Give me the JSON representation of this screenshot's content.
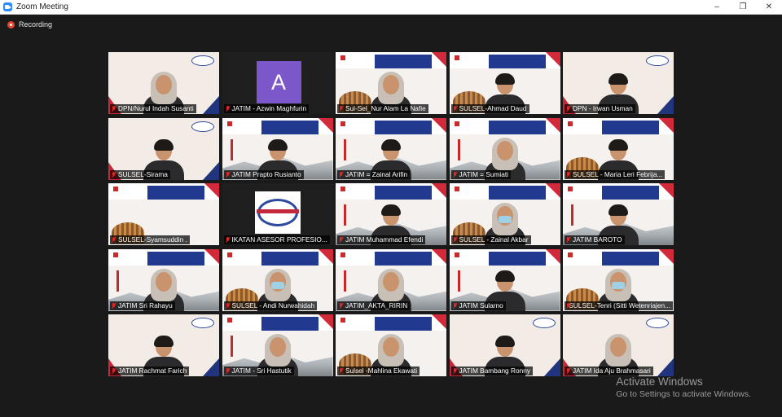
{
  "window": {
    "title": "Zoom Meeting",
    "controls": {
      "minimize": "–",
      "maximize": "❐",
      "close": "✕"
    }
  },
  "recording": {
    "label": "Recording"
  },
  "participants": [
    {
      "name": "DPN/Nurul Indah Susanti",
      "bg": "cream",
      "person": "hijab",
      "active": true
    },
    {
      "name": "JATIM - Azwin Maghfurin",
      "bg": "black",
      "avatar_letter": "A"
    },
    {
      "name": "Sul-Sel_Nur Alam La Nafie",
      "bg": "iaspro",
      "person": "hijab"
    },
    {
      "name": "SULSEL-Ahmad Daud",
      "bg": "iaspro",
      "person": "man"
    },
    {
      "name": "DPN - Irwan Usman",
      "bg": "cream",
      "person": "man"
    },
    {
      "name": "SULSEL-Sirama",
      "bg": "cream",
      "person": "man"
    },
    {
      "name": "JATIM Prapto Rusianto",
      "bg": "jatim",
      "person": "man"
    },
    {
      "name": "JATIM = Zainal Arifin",
      "bg": "jatim",
      "person": "man"
    },
    {
      "name": "JATIM = Sumiati",
      "bg": "jatim",
      "person": "hijab"
    },
    {
      "name": "SULSEL - Maria Leri Febrija...",
      "bg": "iaspro",
      "person": "man"
    },
    {
      "name": "SULSEL-Syamsuddin .",
      "bg": "iaspro",
      "person": "none"
    },
    {
      "name": "IKATAN ASESOR PROFESIO...",
      "bg": "black",
      "logo": "iaspro"
    },
    {
      "name": "JATIM Muhammad Efendi",
      "bg": "jatim",
      "person": "man"
    },
    {
      "name": "SULSEL - Zainal Akbar",
      "bg": "iaspro",
      "person": "mask"
    },
    {
      "name": "JATIM BAROTO",
      "bg": "jatim",
      "person": "man"
    },
    {
      "name": "JATIM Sri Rahayu",
      "bg": "jatim",
      "person": "hijab"
    },
    {
      "name": "SULSEL - Andi Nurwahidah",
      "bg": "iaspro",
      "person": "mask"
    },
    {
      "name": "JATIM_AKTA_RIRIN",
      "bg": "jatim",
      "person": "hijab"
    },
    {
      "name": "JATIM Sularno",
      "bg": "jatim",
      "person": "man"
    },
    {
      "name": "SULSEL-Tenri (Sitti Wetenriajen...",
      "bg": "iaspro",
      "person": "mask"
    },
    {
      "name": "JATIM Rachmat Farich",
      "bg": "cream",
      "person": "man"
    },
    {
      "name": "JATIM - Sri Hastutik",
      "bg": "jatim",
      "person": "hijab"
    },
    {
      "name": "Sulsel -Mahlina Ekawati",
      "bg": "iaspro",
      "person": "hijab"
    },
    {
      "name": "JATIM Bambang Ronny",
      "bg": "cream",
      "person": "man"
    },
    {
      "name": "JATIM Ida Aju Brahmasari",
      "bg": "cream",
      "person": "hijab"
    }
  ],
  "watermark": {
    "title": "Activate Windows",
    "subtitle": "Go to Settings to activate Windows."
  },
  "colors": {
    "accent_active": "#b8e04a",
    "mic_muted": "#e02828",
    "avatar": "#7c57c9"
  }
}
